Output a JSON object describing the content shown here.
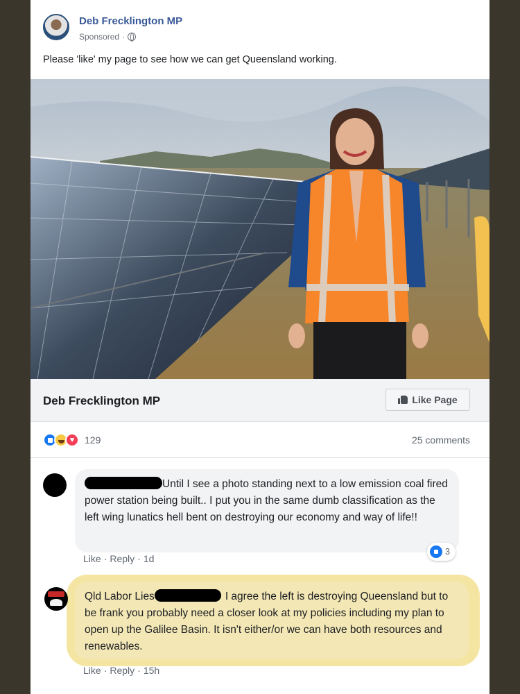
{
  "post": {
    "author": "Deb Frecklington MP",
    "sponsored": "Sponsored",
    "separator": "·",
    "text": "Please 'like' my page to see how we can get Queensland working."
  },
  "link_bar": {
    "page_name": "Deb Frecklington MP",
    "like_button": "Like Page"
  },
  "reactions": {
    "count": "129",
    "comments": "25 comments"
  },
  "comments": [
    {
      "text": "Until I see a photo standing next to a low emission coal fired power station being built.. I put you in the same dumb classification as the left wing lunatics hell bent on destroying our economy and way of life!!",
      "like": "Like",
      "reply": "Reply",
      "time": "1d",
      "reaction_count": "3"
    },
    {
      "author": "Qld Labor Lies",
      "text": "I agree the left is destroying Queensland but to be frank you probably need a closer look at my policies including my plan to open up the Galilee Basin. It isn't either/or we can have both resources and renewables.",
      "like": "Like",
      "reply": "Reply",
      "time": "15h"
    }
  ],
  "colors": {
    "facebook_blue": "#385898",
    "highlight": "#f5e5a3",
    "vest_orange": "#f7862a"
  }
}
